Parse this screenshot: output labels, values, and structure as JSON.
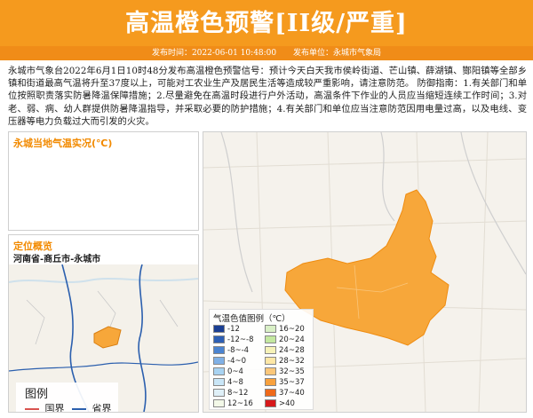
{
  "header": {
    "title": "高温橙色预警[II级/严重]",
    "publish_time": "发布时间：2022-06-01 10:48:00",
    "publish_unit": "发布单位：永城市气象局"
  },
  "description": "永城市气象台2022年6月1日10时48分发布高温橙色预警信号：预计今天白天我市侯岭街道、芒山镇、薛湖镇、酂阳镇等全部乡镇和街道最高气温将升至37度以上，可能对工农业生产及居民生活等造成较严重影响，请注意防范。 防御指南：1.有关部门和单位按照职责落实防暑降温保障措施；2.尽量避免在高温时段进行户外活动，高温条件下作业的人员应当缩短连续工作时间；3.对老、弱、病、幼人群提供防暑降温指导，并采取必要的防护措施；4.有关部门和单位应当注意防范因用电量过高，以及电线、变压器等电力负载过大而引发的火灾。",
  "live_panel": {
    "title": "永城当地气温实况(℃)"
  },
  "location_panel": {
    "title": "定位概览",
    "subtitle": "河南省-商丘市-永城市",
    "legend_title": "图例",
    "legend_items": [
      {
        "label": "国界",
        "color": "#d9534f"
      },
      {
        "label": "省界",
        "color": "#2b5fae"
      }
    ]
  },
  "main_map": {
    "region_color": "#f7a73a",
    "legend_title": "气温色值图例（℃）",
    "legend_items": [
      {
        "label": "-12",
        "color": "#1b3f93"
      },
      {
        "label": "-12~-8",
        "color": "#2d5fb5"
      },
      {
        "label": "-8~-4",
        "color": "#4b84d1"
      },
      {
        "label": "-4~0",
        "color": "#7fb0e6"
      },
      {
        "label": "0~4",
        "color": "#a8d3f2"
      },
      {
        "label": "4~8",
        "color": "#c9e6f7"
      },
      {
        "label": "8~12",
        "color": "#dff0f8"
      },
      {
        "label": "12~16",
        "color": "#f3f9e8"
      },
      {
        "label": "16~20",
        "color": "#d9f0c6"
      },
      {
        "label": "20~24",
        "color": "#c4e8a0"
      },
      {
        "label": "24~28",
        "color": "#f6f2b8"
      },
      {
        "label": "28~32",
        "color": "#fde7a6"
      },
      {
        "label": "32~35",
        "color": "#fbc77a"
      },
      {
        "label": "35~37",
        "color": "#f8a13d"
      },
      {
        "label": "37~40",
        "color": "#ef6a1a"
      },
      {
        "label": ">40",
        "color": "#d7191c"
      }
    ]
  }
}
